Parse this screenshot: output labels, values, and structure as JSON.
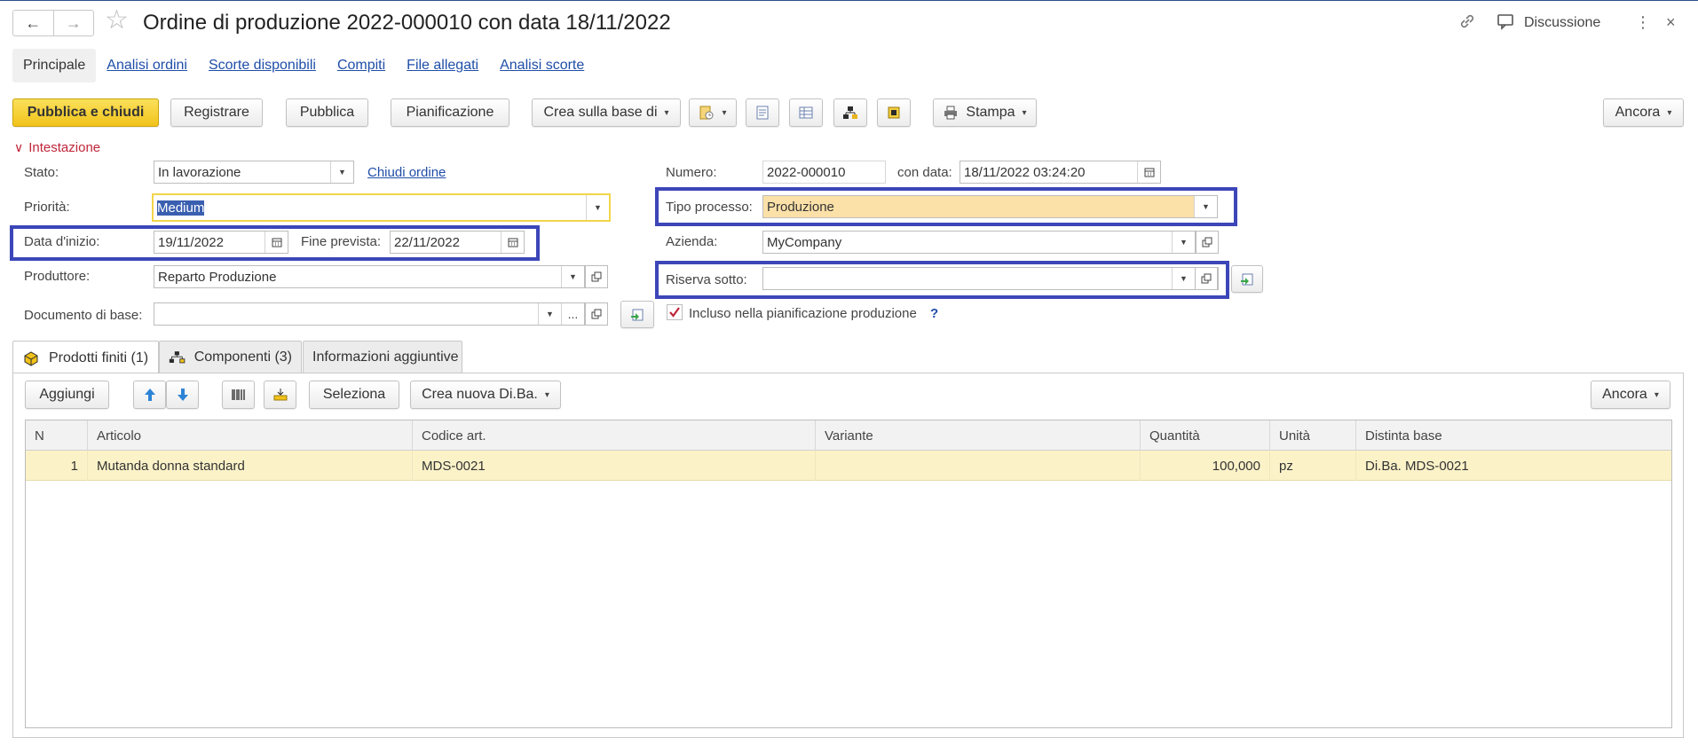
{
  "window": {
    "title": "Ordine di produzione 2022-000010 con data 18/11/2022",
    "discussion_label": "Discussione"
  },
  "section_tabs": [
    {
      "label": "Principale",
      "active": true
    },
    {
      "label": "Analisi ordini"
    },
    {
      "label": "Scorte disponibili"
    },
    {
      "label": "Compiti"
    },
    {
      "label": "File allegati"
    },
    {
      "label": "Analisi scorte"
    }
  ],
  "toolbar": {
    "publish_close": "Pubblica e chiudi",
    "register": "Registrare",
    "publish": "Pubblica",
    "planning": "Pianificazione",
    "create_based_on": "Crea sulla base di",
    "print": "Stampa",
    "more": "Ancora"
  },
  "header": {
    "group_title": "Intestazione",
    "stato_label": "Stato:",
    "stato_value": "In lavorazione",
    "close_order_link": "Chiudi ordine",
    "priorita_label": "Priorità:",
    "priorita_value": "Medium",
    "data_inizio_label": "Data d'inizio:",
    "data_inizio_value": "19/11/2022",
    "fine_prevista_label": "Fine prevista:",
    "fine_prevista_value": "22/11/2022",
    "produttore_label": "Produttore:",
    "produttore_value": "Reparto Produzione",
    "documento_base_label": "Documento di base:",
    "documento_base_value": "",
    "numero_label": "Numero:",
    "numero_value": "2022-000010",
    "con_data_label": "con data:",
    "con_data_value": "18/11/2022 03:24:20",
    "tipo_processo_label": "Tipo processo:",
    "tipo_processo_value": "Produzione",
    "azienda_label": "Azienda:",
    "azienda_value": "MyCompany",
    "riserva_sotto_label": "Riserva sotto:",
    "riserva_sotto_value": "",
    "incluso_label": "Incluso nella pianificazione produzione",
    "incluso_checked": true,
    "help_mark": "?"
  },
  "inner_tabs": [
    {
      "label": "Prodotti finiti (1)",
      "active": true
    },
    {
      "label": "Componenti (3)"
    },
    {
      "label": "Informazioni aggiuntive"
    }
  ],
  "table_toolbar": {
    "add": "Aggiungi",
    "select": "Seleziona",
    "create_bom": "Crea nuova Di.Ba.",
    "more": "Ancora"
  },
  "table": {
    "columns": [
      "N",
      "Articolo",
      "Codice art.",
      "Variante",
      "Quantità",
      "Unità",
      "Distinta base"
    ],
    "rows": [
      {
        "n": "1",
        "articolo": "Mutanda donna standard",
        "codice": "MDS-0021",
        "variante": "",
        "quantita": "100,000",
        "unita": "pz",
        "distinta": "Di.Ba. MDS-0021"
      }
    ]
  },
  "colors": {
    "accent_blue_link": "#1f4ea8",
    "primary_button": "#f1c21a",
    "highlight_box": "#3c46b8",
    "selected_row": "#fbf2c8",
    "group_title_red": "#c0263a"
  }
}
